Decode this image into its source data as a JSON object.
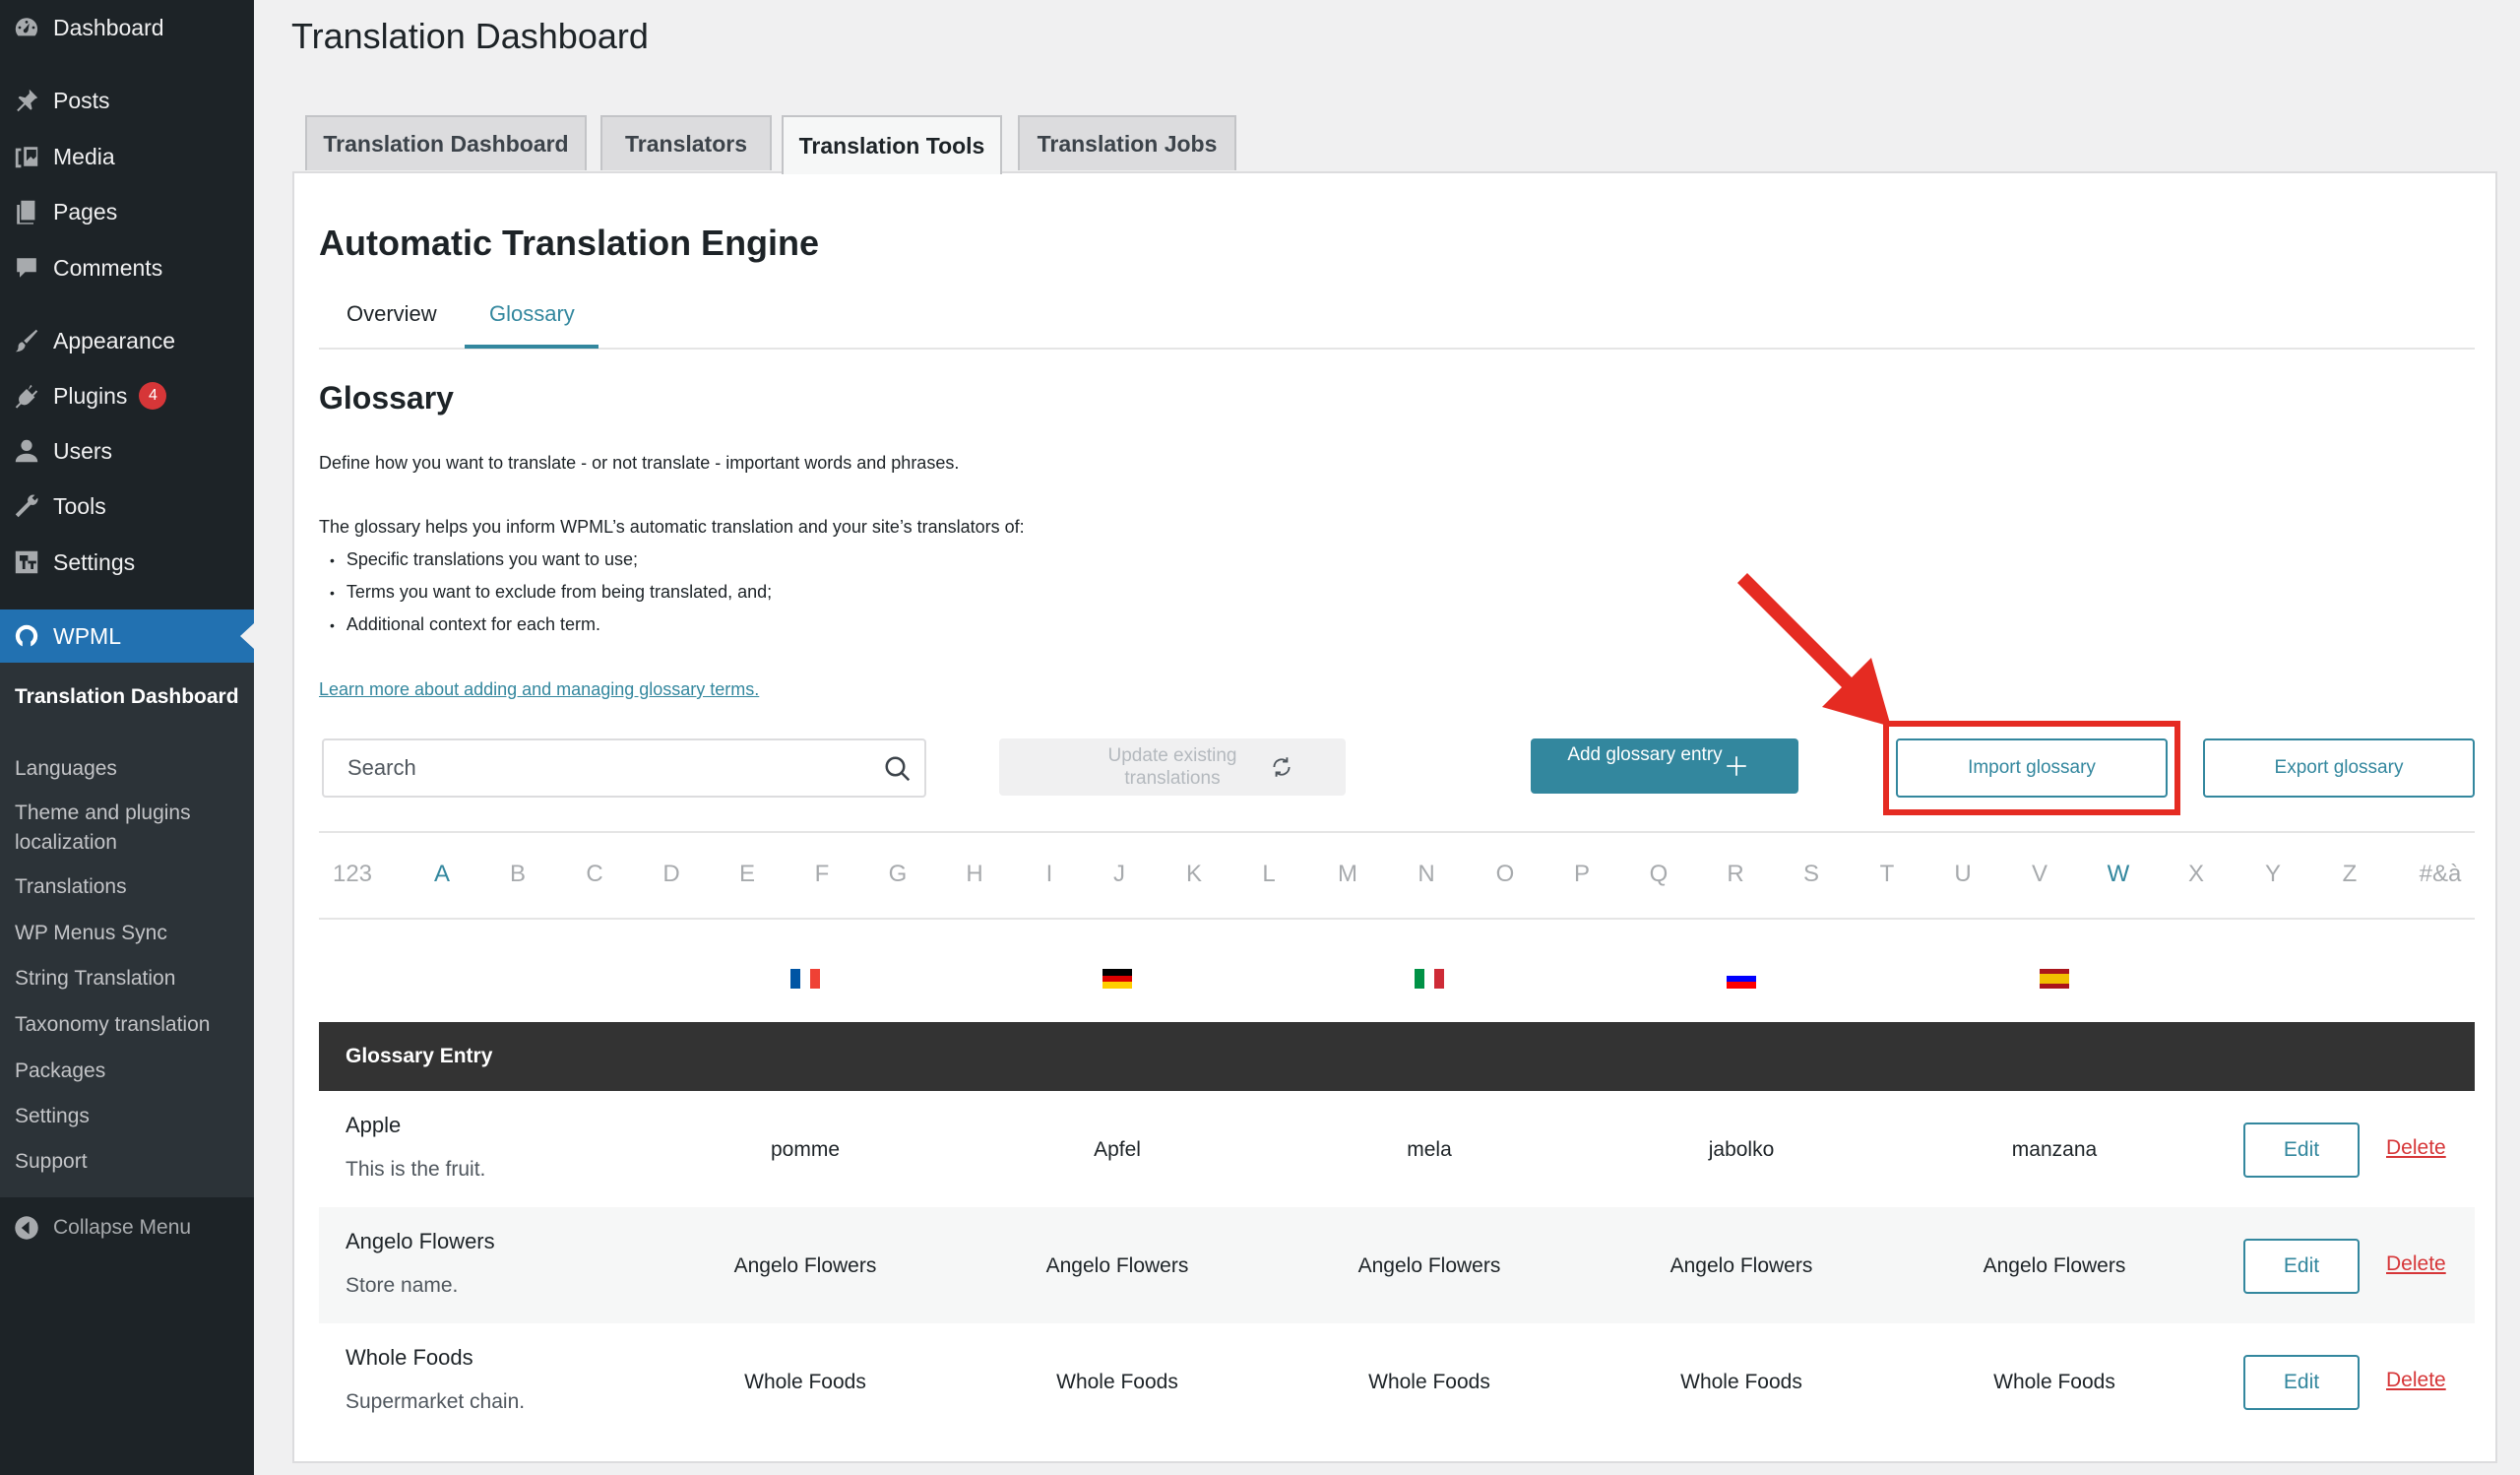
{
  "sidebar": {
    "items": [
      {
        "label": "Dashboard",
        "icon": "dashboard-icon"
      },
      {
        "label": "Posts",
        "icon": "pin-icon"
      },
      {
        "label": "Media",
        "icon": "media-icon"
      },
      {
        "label": "Pages",
        "icon": "pages-icon"
      },
      {
        "label": "Comments",
        "icon": "comment-icon"
      },
      {
        "label": "Appearance",
        "icon": "brush-icon"
      },
      {
        "label": "Plugins",
        "icon": "plug-icon",
        "badge": "4"
      },
      {
        "label": "Users",
        "icon": "user-icon"
      },
      {
        "label": "Tools",
        "icon": "wrench-icon"
      },
      {
        "label": "Settings",
        "icon": "settings-icon"
      }
    ],
    "wpml": {
      "label": "WPML",
      "icon": "wpml-icon"
    },
    "submenu": [
      "Translation Dashboard",
      "Languages",
      "Theme and plugins localization",
      "Translations",
      "WP Menus Sync",
      "String Translation",
      "Taxonomy translation",
      "Packages",
      "Settings",
      "Support"
    ],
    "collapse": "Collapse Menu"
  },
  "header": {
    "title": "Translation Dashboard",
    "tabs": [
      "Translation Dashboard",
      "Translators",
      "Translation Tools",
      "Translation Jobs"
    ],
    "active_tab": "Translation Tools"
  },
  "main": {
    "engine_title": "Automatic Translation Engine",
    "subtabs": [
      "Overview",
      "Glossary"
    ],
    "active_subtab": "Glossary",
    "glossary_title": "Glossary",
    "intro": "Define how you want to translate - or not translate - important words and phrases.",
    "helps": "The glossary helps you inform WPML’s automatic translation and your site’s translators of:",
    "bullets": [
      "Specific translations you want to use;",
      "Terms you want to exclude from being translated, and;",
      "Additional context for each term."
    ],
    "learn_link": "Learn more about adding and managing glossary terms.",
    "search_placeholder": "Search",
    "update_label": "Update existing translations",
    "add_label": "Add glossary entry",
    "import_label": "Import glossary",
    "export_label": "Export glossary",
    "letters": [
      "123",
      "A",
      "B",
      "C",
      "D",
      "E",
      "F",
      "G",
      "H",
      "I",
      "J",
      "K",
      "L",
      "M",
      "N",
      "O",
      "P",
      "Q",
      "R",
      "S",
      "T",
      "U",
      "V",
      "W",
      "X",
      "Y",
      "Z",
      "#&à"
    ],
    "active_letters": [
      "A",
      "W"
    ],
    "flags": [
      "flag-france-icon",
      "flag-germany-icon",
      "flag-italy-icon",
      "flag-slovenia-icon",
      "flag-spain-icon"
    ],
    "table_header": "Glossary Entry",
    "edit_label": "Edit",
    "delete_label": "Delete",
    "rows": [
      {
        "term": "Apple",
        "note": "This is the fruit.",
        "translations": [
          "pomme",
          "Apfel",
          "mela",
          "jabolko",
          "manzana"
        ]
      },
      {
        "term": "Angelo Flowers",
        "note": "Store name.",
        "translations": [
          "Angelo Flowers",
          "Angelo Flowers",
          "Angelo Flowers",
          "Angelo Flowers",
          "Angelo Flowers"
        ]
      },
      {
        "term": "Whole Foods",
        "note": "Supermarket chain.",
        "translations": [
          "Whole Foods",
          "Whole Foods",
          "Whole Foods",
          "Whole Foods",
          "Whole Foods"
        ]
      }
    ]
  },
  "colors": {
    "sidebar_bg": "#1d2327",
    "wpml_blue": "#2271b1",
    "accent": "#33879e",
    "highlight_red": "#e52b22",
    "delete_red": "#d63638"
  }
}
